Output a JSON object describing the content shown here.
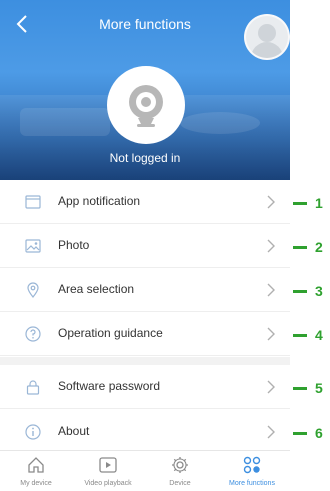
{
  "header": {
    "title": "More functions",
    "login_status": "Not logged in"
  },
  "menu": {
    "group1": [
      {
        "label": "App notification",
        "icon": "message-icon"
      },
      {
        "label": "Photo",
        "icon": "photo-icon"
      },
      {
        "label": "Area selection",
        "icon": "location-pin-icon"
      },
      {
        "label": "Operation guidance",
        "icon": "help-circle-icon"
      }
    ],
    "group2": [
      {
        "label": "Software password",
        "icon": "lock-icon"
      },
      {
        "label": "About",
        "icon": "info-circle-icon"
      }
    ]
  },
  "annotations": [
    "1",
    "2",
    "3",
    "4",
    "5",
    "6"
  ],
  "bottom_nav": [
    {
      "label": "My device",
      "icon": "home-icon",
      "active": false
    },
    {
      "label": "Video playback",
      "icon": "play-icon",
      "active": false
    },
    {
      "label": "Device",
      "icon": "gear-icon",
      "active": false
    },
    {
      "label": "More functions",
      "icon": "grid-icon",
      "active": true
    }
  ],
  "colors": {
    "accent": "#3d8fe0",
    "annotation": "#2fa12f",
    "text": "#333333",
    "muted": "#8a8a8a"
  }
}
